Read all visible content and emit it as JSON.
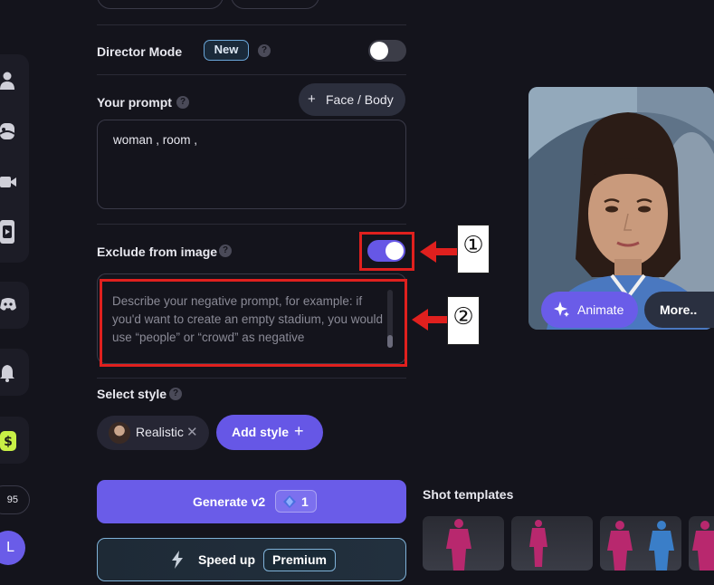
{
  "sidebar": {
    "credits": "95",
    "avatar_letter": "L",
    "icons": [
      "user-icon",
      "face-icon",
      "video-icon",
      "media-icon",
      "discord-icon",
      "bell-icon",
      "dollar-icon"
    ]
  },
  "director_mode": {
    "label": "Director Mode",
    "badge": "New",
    "enabled": false
  },
  "prompt": {
    "label": "Your prompt",
    "face_body_button": "Face / Body",
    "value": "woman , room ,"
  },
  "exclude": {
    "label": "Exclude from image",
    "enabled": true,
    "placeholder": "Describe your negative prompt, for example: if you'd want to create an empty stadium, you would use “people” or “crowd” as negative"
  },
  "annotations": {
    "marker_1": "①",
    "marker_2": "②",
    "color": "#e0201e"
  },
  "style": {
    "label": "Select style",
    "selected_chip": "Realistic",
    "add_button": "Add style"
  },
  "generate": {
    "label": "Generate v2",
    "cost": "1"
  },
  "speed_up": {
    "label": "Speed up",
    "badge": "Premium"
  },
  "preview": {
    "animate_button": "Animate",
    "more_button": "More.."
  },
  "shot_templates": {
    "title": "Shot templates"
  },
  "colors": {
    "accent": "#6a5ce8",
    "background": "#14141c",
    "toggle_on": "#6657e6"
  }
}
